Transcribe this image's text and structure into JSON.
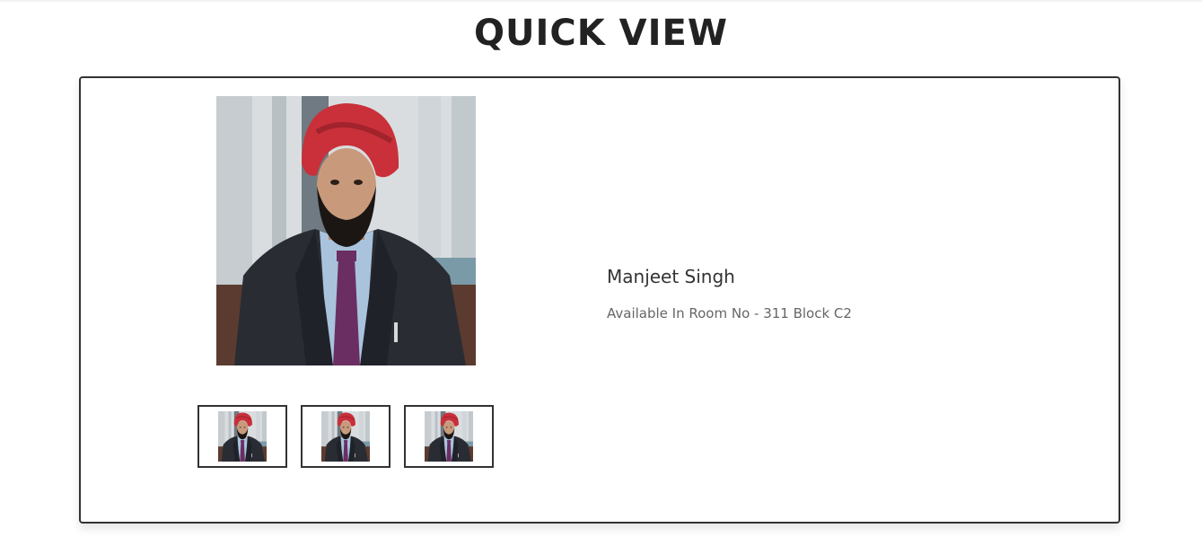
{
  "header": {
    "title": "QUICK VIEW"
  },
  "profile": {
    "name": "Manjeet Singh",
    "location": "Available In Room No - 311 Block C2"
  },
  "gallery": {
    "main_image": "portrait-photo",
    "thumbnails": [
      "thumbnail-1",
      "thumbnail-2",
      "thumbnail-3"
    ]
  },
  "colors": {
    "turban": "#c9303a",
    "suit": "#2a2c33",
    "shirt": "#a9c3dc",
    "tie": "#6a2e63",
    "background": "#d9dde0",
    "border": "#333333"
  }
}
